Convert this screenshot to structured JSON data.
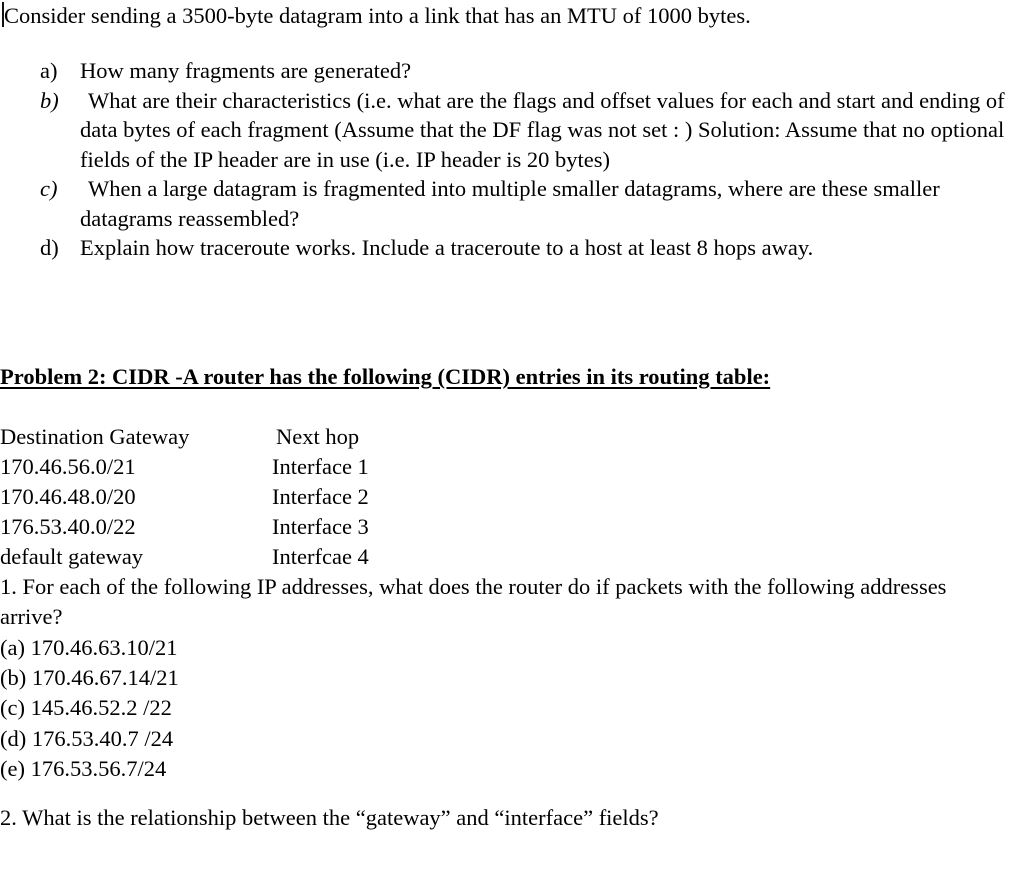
{
  "document": {
    "intro": "Consider sending a 3500-byte datagram into a link that has an MTU of 1000 bytes.",
    "questions": [
      {
        "marker": "a)",
        "marker_style": "roman",
        "text": "How many fragments are generated?"
      },
      {
        "marker": "b)",
        "marker_style": "italic",
        "text": "What are their characteristics (i.e. what are the flags and offset values for each and start and ending of data bytes of each fragment (Assume that the DF flag was not set : ) Solution: Assume that no optional fields of the IP header are in use (i.e. IP header is 20 bytes)"
      },
      {
        "marker": "c)",
        "marker_style": "italic",
        "text": "When a large datagram is fragmented into multiple smaller datagrams, where are these smaller datagrams reassembled?"
      },
      {
        "marker": "d)",
        "marker_style": "roman",
        "text": "Explain how traceroute works. Include a traceroute to a host at least 8 hops away."
      }
    ],
    "problem2": {
      "heading": "Problem 2: CIDR -A router has the following (CIDR) entries in its routing table:",
      "table": {
        "headers": [
          "Destination Gateway",
          "Next hop"
        ],
        "rows": [
          [
            "170.46.56.0/21",
            "Interface 1"
          ],
          [
            "170.46.48.0/20",
            "Interface 2"
          ],
          [
            "176.53.40.0/22",
            "Interface 3"
          ],
          [
            "default gateway",
            "Interfcae 4"
          ]
        ]
      },
      "question1": "1. For each of the following IP addresses, what does the router do if packets with the following addresses arrive?",
      "addresses": [
        "(a) 170.46.63.10/21",
        "(b) 170.46.67.14/21",
        "(c) 145.46.52.2 /22",
        "(d) 176.53.40.7 /24",
        "(e) 176.53.56.7/24"
      ],
      "question2": "2. What is the relationship between the “gateway” and “interface” fields?"
    }
  }
}
